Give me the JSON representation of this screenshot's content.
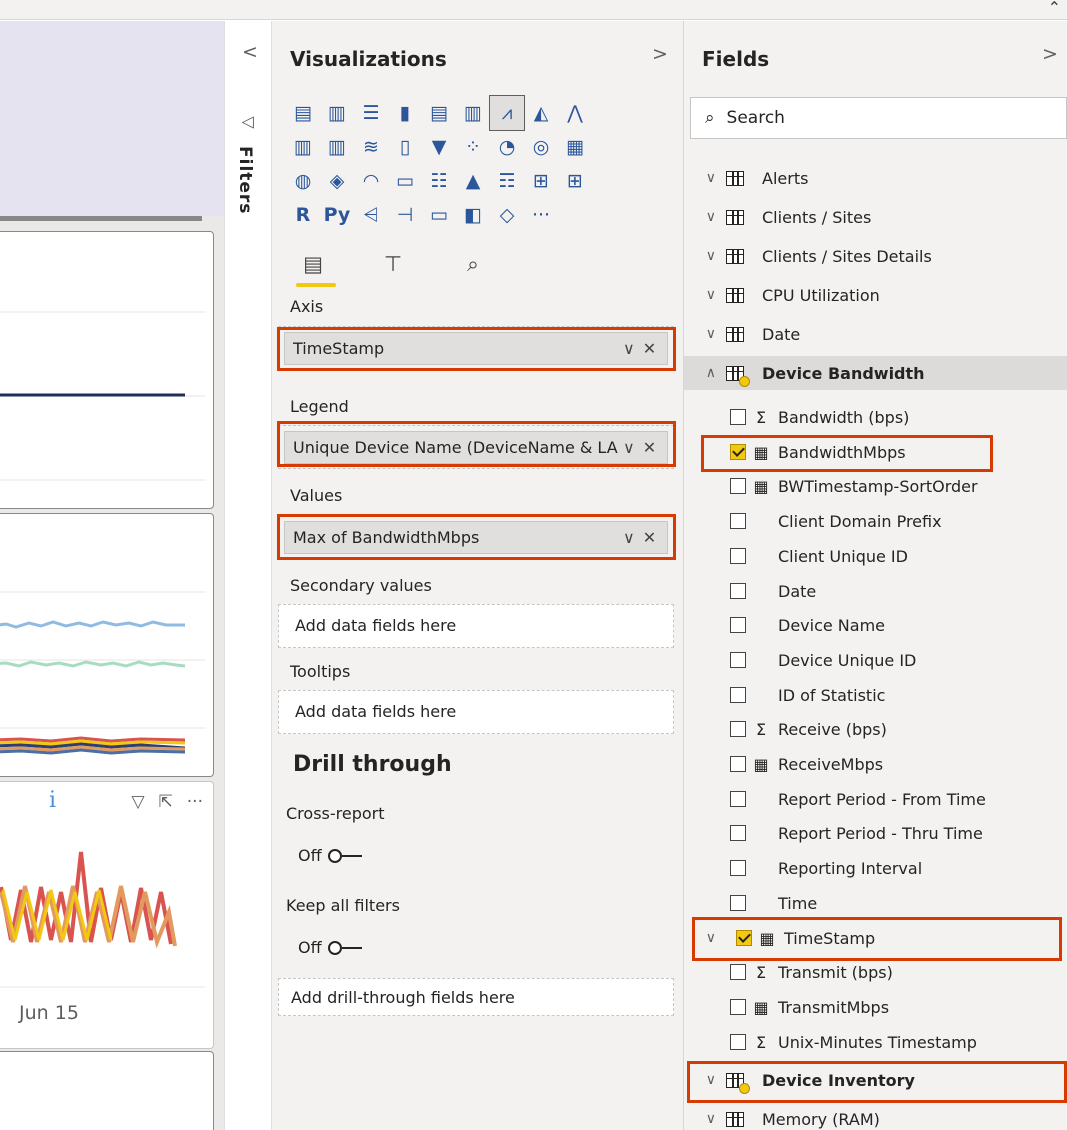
{
  "visualizations": {
    "title": "Visualizations",
    "axis_label": "Axis",
    "axis_field": "TimeStamp",
    "legend_label": "Legend",
    "legend_field": "Unique Device Name (DeviceName & LAN I",
    "values_label": "Values",
    "values_field": "Max of BandwidthMbps",
    "secondary_label": "Secondary values",
    "secondary_placeholder": "Add data fields here",
    "tooltips_label": "Tooltips",
    "tooltips_placeholder": "Add data fields here",
    "drill_title": "Drill through",
    "cross_report_label": "Cross-report",
    "cross_report_state": "Off",
    "keep_filters_label": "Keep all filters",
    "keep_filters_state": "Off",
    "drill_placeholder": "Add drill-through fields here",
    "icon_text": {
      "r": "R",
      "py": "Py",
      "more": "···"
    }
  },
  "filters": {
    "label": "Filters"
  },
  "canvas": {
    "axis_tick": "Jun 15",
    "more_icon": "···"
  },
  "fields": {
    "title": "Fields",
    "search_placeholder": "Search",
    "tables_top": [
      "Alerts",
      "Clients / Sites",
      "Clients / Sites Details",
      "CPU Utilization",
      "Date"
    ],
    "expanded_table": "Device Bandwidth",
    "items": [
      {
        "name": "Bandwidth (bps)",
        "type": "Σ",
        "checked": false
      },
      {
        "name": "BandwidthMbps",
        "type": "calc",
        "checked": true
      },
      {
        "name": "BWTimestamp-SortOrder",
        "type": "calc",
        "checked": false
      },
      {
        "name": "Client Domain Prefix",
        "type": "",
        "checked": false
      },
      {
        "name": "Client Unique ID",
        "type": "",
        "checked": false
      },
      {
        "name": "Date",
        "type": "",
        "checked": false
      },
      {
        "name": "Device Name",
        "type": "",
        "checked": false
      },
      {
        "name": "Device Unique ID",
        "type": "",
        "checked": false
      },
      {
        "name": "ID of Statistic",
        "type": "",
        "checked": false
      },
      {
        "name": "Receive (bps)",
        "type": "Σ",
        "checked": false
      },
      {
        "name": "ReceiveMbps",
        "type": "calc",
        "checked": false
      },
      {
        "name": "Report Period - From Time",
        "type": "",
        "checked": false
      },
      {
        "name": "Report Period - Thru Time",
        "type": "",
        "checked": false
      },
      {
        "name": "Reporting Interval",
        "type": "",
        "checked": false
      },
      {
        "name": "Time",
        "type": "",
        "checked": false
      },
      {
        "name": "TimeStamp",
        "type": "date",
        "checked": true
      },
      {
        "name": "Transmit (bps)",
        "type": "Σ",
        "checked": false
      },
      {
        "name": "TransmitMbps",
        "type": "calc",
        "checked": false
      },
      {
        "name": "Unix-Minutes Timestamp",
        "type": "Σ",
        "checked": false
      }
    ],
    "tables_bottom": [
      "Device Inventory",
      "Memory (RAM)"
    ]
  },
  "colors": {
    "accent": "#f2c811",
    "highlight": "#d83b01",
    "icon_blue": "#2b579a"
  }
}
